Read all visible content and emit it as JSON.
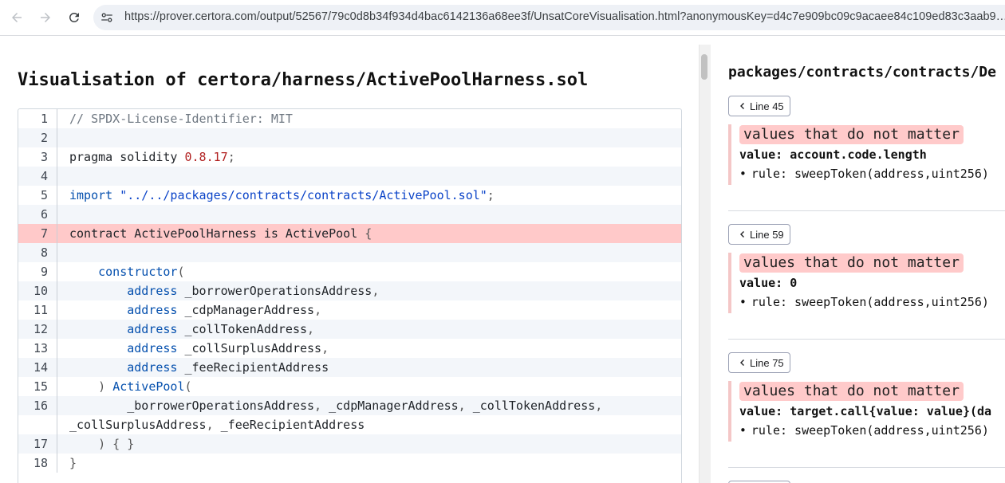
{
  "browser": {
    "url": "https://prover.certora.com/output/52567/79c0d8b34f934d4bac6142136a68ee3f/UnsatCoreVisualisation.html?anonymousKey=d4c7e909bc09c9acaee84c109ed83c3aab9…",
    "icons": {
      "back": "arrow-left-icon",
      "forward": "arrow-right-icon",
      "reload": "reload-icon",
      "site": "site-settings-icon"
    }
  },
  "source": {
    "title": "Visualisation of certora/harness/ActivePoolHarness.sol",
    "lines": [
      {
        "n": "1",
        "tokens": [
          {
            "t": "// SPDX-License-Identifier: MIT",
            "c": "com"
          }
        ]
      },
      {
        "n": "2",
        "tokens": []
      },
      {
        "n": "3",
        "tokens": [
          {
            "t": "pragma solidity ",
            "c": ""
          },
          {
            "t": "0.8.17",
            "c": "num"
          },
          {
            "t": ";",
            "c": "punc"
          }
        ]
      },
      {
        "n": "4",
        "tokens": []
      },
      {
        "n": "5",
        "tokens": [
          {
            "t": "import ",
            "c": "kw"
          },
          {
            "t": "\"../../packages/contracts/contracts/ActivePool.sol\"",
            "c": "str"
          },
          {
            "t": ";",
            "c": "punc"
          }
        ]
      },
      {
        "n": "6",
        "tokens": []
      },
      {
        "n": "7",
        "highlight": true,
        "tokens": [
          {
            "t": "contract ActivePoolHarness is ActivePool ",
            "c": ""
          },
          {
            "t": "{",
            "c": "punc"
          }
        ]
      },
      {
        "n": "8",
        "tokens": []
      },
      {
        "n": "9",
        "tokens": [
          {
            "t": "    ",
            "c": ""
          },
          {
            "t": "constructor",
            "c": "kw"
          },
          {
            "t": "(",
            "c": "punc"
          }
        ]
      },
      {
        "n": "10",
        "tokens": [
          {
            "t": "        ",
            "c": ""
          },
          {
            "t": "address",
            "c": "kw"
          },
          {
            "t": " _borrowerOperationsAddress",
            "c": ""
          },
          {
            "t": ",",
            "c": "punc"
          }
        ]
      },
      {
        "n": "11",
        "tokens": [
          {
            "t": "        ",
            "c": ""
          },
          {
            "t": "address",
            "c": "kw"
          },
          {
            "t": " _cdpManagerAddress",
            "c": ""
          },
          {
            "t": ",",
            "c": "punc"
          }
        ]
      },
      {
        "n": "12",
        "tokens": [
          {
            "t": "        ",
            "c": ""
          },
          {
            "t": "address",
            "c": "kw"
          },
          {
            "t": " _collTokenAddress",
            "c": ""
          },
          {
            "t": ",",
            "c": "punc"
          }
        ]
      },
      {
        "n": "13",
        "tokens": [
          {
            "t": "        ",
            "c": ""
          },
          {
            "t": "address",
            "c": "kw"
          },
          {
            "t": " _collSurplusAddress",
            "c": ""
          },
          {
            "t": ",",
            "c": "punc"
          }
        ]
      },
      {
        "n": "14",
        "tokens": [
          {
            "t": "        ",
            "c": ""
          },
          {
            "t": "address",
            "c": "kw"
          },
          {
            "t": " _feeRecipientAddress",
            "c": ""
          }
        ]
      },
      {
        "n": "15",
        "tokens": [
          {
            "t": "    ",
            "c": ""
          },
          {
            "t": ")",
            "c": "punc"
          },
          {
            "t": " ",
            "c": ""
          },
          {
            "t": "ActivePool",
            "c": "kw"
          },
          {
            "t": "(",
            "c": "punc"
          }
        ]
      },
      {
        "n": "16",
        "tokens": [
          {
            "t": "        _borrowerOperationsAddress",
            "c": ""
          },
          {
            "t": ",",
            "c": "punc"
          },
          {
            "t": " _cdpManagerAddress",
            "c": ""
          },
          {
            "t": ",",
            "c": "punc"
          },
          {
            "t": " _collTokenAddress",
            "c": ""
          },
          {
            "t": ",",
            "c": "punc"
          }
        ]
      },
      {
        "n": "",
        "tokens": [
          {
            "t": "_collSurplusAddress",
            "c": ""
          },
          {
            "t": ",",
            "c": "punc"
          },
          {
            "t": " _feeRecipientAddress",
            "c": ""
          }
        ]
      },
      {
        "n": "17",
        "tokens": [
          {
            "t": "    ",
            "c": ""
          },
          {
            "t": ") { }",
            "c": "punc"
          }
        ]
      },
      {
        "n": "18",
        "tokens": [
          {
            "t": "}",
            "c": "punc"
          }
        ]
      }
    ]
  },
  "details": {
    "path": "packages/contracts/contracts/De",
    "chevron_icon": "chevron-left-icon",
    "entries": [
      {
        "line_label": "Line 45",
        "tag": "values that do not matter",
        "value": "value: account.code.length",
        "rule": "rule: sweepToken(address,uint256)"
      },
      {
        "line_label": "Line 59",
        "tag": "values that do not matter",
        "value": "value: 0",
        "rule": "rule: sweepToken(address,uint256)"
      },
      {
        "line_label": "Line 75",
        "tag": "values that do not matter",
        "value": "value: target.call{value: value}(da",
        "rule": "rule: sweepToken(address,uint256)"
      }
    ]
  }
}
